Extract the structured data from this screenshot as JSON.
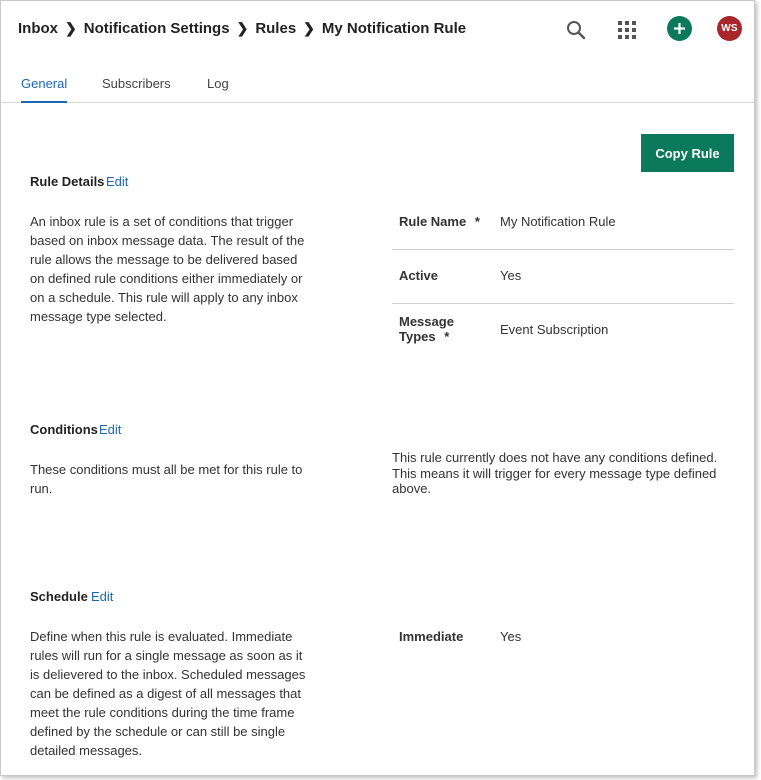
{
  "breadcrumb": [
    "Inbox",
    "Notification Settings",
    "Rules",
    "My Notification Rule"
  ],
  "header": {
    "search_icon": "search-icon",
    "apps_icon": "grid-icon",
    "add_icon": "plus-icon",
    "avatar_initials": "WS"
  },
  "tabs": [
    {
      "label": "General",
      "active": true
    },
    {
      "label": "Subscribers",
      "active": false
    },
    {
      "label": "Log",
      "active": false
    }
  ],
  "copy_rule_label": "Copy Rule",
  "rule_details": {
    "title": "Rule Details",
    "edit_label": "Edit",
    "description": "An inbox rule is a set of conditions that trigger based on inbox message data. The result of the rule allows the message to be delivered based on defined rule conditions either immediately or on a schedule. This rule will apply to any inbox message type selected.",
    "fields": [
      {
        "label": "Rule Name",
        "required": "*",
        "value": "My Notification Rule"
      },
      {
        "label": "Active",
        "required": "",
        "value": "Yes"
      },
      {
        "label_line1": "Message",
        "label_line2": "Types",
        "required": "*",
        "value": "Event Subscription"
      }
    ]
  },
  "conditions": {
    "title": "Conditions",
    "edit_label": "Edit",
    "description": "These conditions must all be met for this rule to run.",
    "note": "This rule currently does not have any conditions defined. This means it will trigger for every message type defined above."
  },
  "schedule": {
    "title": "Schedule",
    "edit_label": "Edit",
    "description": "Define when this rule is evaluated. Immediate rules will run for a single message as soon as it is delievered to the inbox. Scheduled messages can be defined as a digest of all messages that meet the rule conditions during the time frame defined by the schedule or can still be single detailed messages.",
    "field_label": "Immediate",
    "field_value": "Yes"
  },
  "colors": {
    "accent": "#0b7a5c",
    "link": "#1d68b3",
    "avatar": "#a9272b"
  }
}
